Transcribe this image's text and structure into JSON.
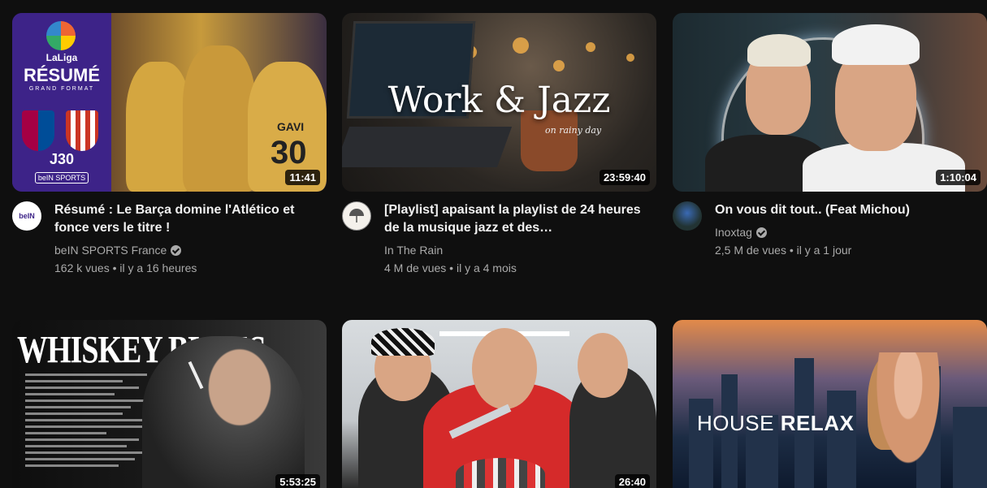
{
  "videos": [
    {
      "title": "Résumé : Le Barça domine l'Atlético et fonce vers le titre !",
      "channel": "beIN SPORTS France",
      "verified": true,
      "views": "162 k vues",
      "age": "il y a 16 heures",
      "duration": "11:41",
      "thumb_text": {
        "league": "LaLiga",
        "headline": "RÉSUMÉ",
        "sub": "GRAND FORMAT",
        "round": "J30",
        "brand": "beIN SPORTS",
        "jersey_name": "GAVI",
        "jersey_number": "30"
      },
      "avatar_text": "beIN"
    },
    {
      "title": "[Playlist] apaisant la playlist de 24 heures de la musique jazz et des…",
      "channel": "In The Rain",
      "verified": false,
      "views": "4 M de vues",
      "age": "il y a 4 mois",
      "duration": "23:59:40",
      "thumb_text": {
        "headline": "Work & Jazz",
        "sub": "on rainy day"
      }
    },
    {
      "title": "On vous dit tout.. (Feat Michou)",
      "channel": "Inoxtag",
      "verified": true,
      "views": "2,5 M de vues",
      "age": "il y a 1 jour",
      "duration": "1:10:04"
    },
    {
      "duration": "5:53:25",
      "thumb_text": {
        "headline": "WHISKEY BLUES"
      }
    },
    {
      "duration": "26:40"
    },
    {
      "thumb_text": {
        "headline_light": "HOUSE ",
        "headline_bold": "RELAX"
      }
    }
  ],
  "separator": " • "
}
